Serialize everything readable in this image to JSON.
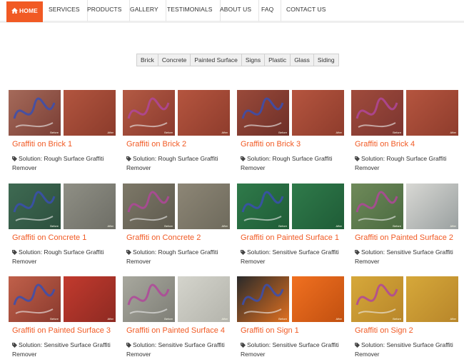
{
  "nav": {
    "items": [
      "HOME",
      "SERVICES",
      "PRODUCTS",
      "GALLERY",
      "TESTIMONIALS",
      "ABOUT US",
      "FAQ",
      "CONTACT US"
    ],
    "accent": "#f15a24"
  },
  "filters": [
    "Brick",
    "Concrete",
    "Painted Surface",
    "Signs",
    "Plastic",
    "Glass",
    "Siding"
  ],
  "gallery": [
    {
      "title": "Graffiti on Brick 1",
      "solution": "Solution: Rough Surface Graffiti Remover",
      "before": "Before",
      "after": "After"
    },
    {
      "title": "Graffiti on Brick 2",
      "solution": "Solution: Rough Surface Graffiti Remover",
      "before": "Before",
      "after": "After"
    },
    {
      "title": "Graffiti on Brick 3",
      "solution": "Solution: Rough Surface Graffiti Remover",
      "before": "Before",
      "after": "After"
    },
    {
      "title": "Graffiti on Brick 4",
      "solution": "Solution: Rough Surface Graffiti Remover",
      "before": "Before",
      "after": "After"
    },
    {
      "title": "Graffiti on Concrete 1",
      "solution": "Solution: Rough Surface Graffiti Remover",
      "before": "Before",
      "after": "After"
    },
    {
      "title": "Graffiti on Concrete 2",
      "solution": "Solution: Rough Surface Graffiti Remover",
      "before": "Before",
      "after": "After"
    },
    {
      "title": "Graffiti on Painted Surface 1",
      "solution": "Solution: Sensitive Surface Graffiti Remover",
      "before": "Before",
      "after": "After"
    },
    {
      "title": "Graffiti on Painted Surface 2",
      "solution": "Solution: Sensitive Surface Graffiti Remover",
      "before": "Before",
      "after": "After"
    },
    {
      "title": "Graffiti on Painted Surface 3",
      "solution": "Solution: Sensitive Surface Graffiti Remover",
      "before": "Before",
      "after": "After"
    },
    {
      "title": "Graffiti on Painted Surface 4",
      "solution": "Solution: Sensitive Surface Graffiti Remover",
      "before": "Before",
      "after": "After"
    },
    {
      "title": "Graffiti on Sign 1",
      "solution": "Solution: Sensitive Surface Graffiti Remover",
      "before": "Before",
      "after": "After"
    },
    {
      "title": "Graffiti on Sign 2",
      "solution": "Solution: Sensitive Surface Graffiti Remover",
      "before": "Before",
      "after": "After"
    }
  ]
}
